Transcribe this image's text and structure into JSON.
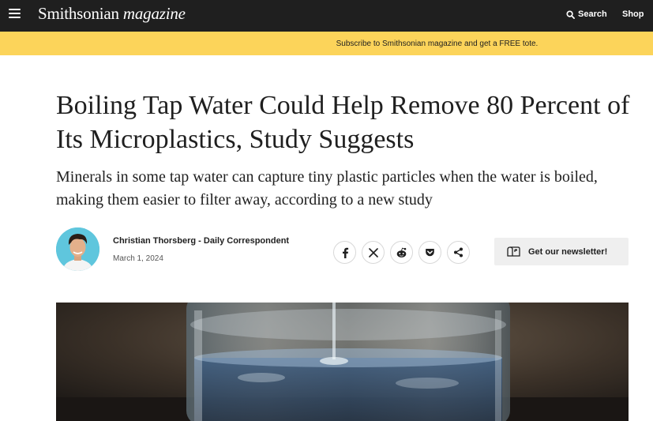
{
  "header": {
    "brand": "Smithsonian",
    "brand_suffix": "magazine",
    "search_label": "Search",
    "shop_label": "Shop"
  },
  "promo": {
    "text": "Subscribe to Smithsonian magazine and get a FREE tote."
  },
  "article": {
    "headline": "Boiling Tap Water Could Help Remove 80 Percent of Its Microplastics, Study Suggests",
    "dek": "Minerals in some tap water can capture tiny plastic particles when the water is boiled, making them easier to filter away, according to a new study",
    "author": "Christian Thorsberg - Daily Correspondent",
    "date": "March 1, 2024"
  },
  "share": {
    "buttons": [
      "facebook-icon",
      "x-icon",
      "reddit-icon",
      "pocket-icon",
      "share-icon"
    ]
  },
  "newsletter": {
    "label": "Get our newsletter!"
  },
  "colors": {
    "topbar": "#1f1f1f",
    "promo": "#fcd45a",
    "avatar_bg": "#5fc6dd",
    "newsletter_bg": "#efefef"
  }
}
